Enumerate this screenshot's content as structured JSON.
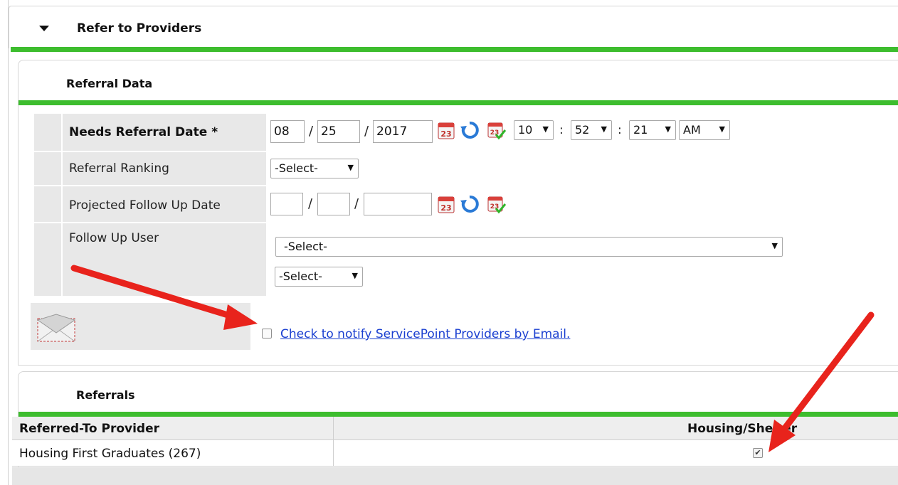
{
  "section": {
    "title": "Refer to Providers"
  },
  "referral_data": {
    "title": "Referral Data",
    "needs_referral_date": {
      "label": "Needs Referral Date",
      "required_mark": "*",
      "month": "08",
      "day": "25",
      "year": "2017",
      "hour": "10",
      "minute": "52",
      "second": "21",
      "ampm": "AM"
    },
    "referral_ranking": {
      "label": "Referral Ranking",
      "value": "-Select-"
    },
    "projected_follow_up_date": {
      "label": "Projected Follow Up Date",
      "month": "",
      "day": "",
      "year": ""
    },
    "follow_up_user": {
      "label": "Follow Up User",
      "value": "-Select-",
      "secondary_value": "-Select-"
    },
    "notify": {
      "label": "Check to notify ServicePoint Providers by Email.",
      "checked": false
    }
  },
  "referrals": {
    "title": "Referrals",
    "columns": [
      "Referred-To Provider",
      "Housing/Shelter"
    ],
    "rows": [
      {
        "provider": "Housing First Graduates (267)",
        "housing_shelter": true
      }
    ]
  },
  "colors": {
    "accent_green": "#3dbd2e",
    "link_blue": "#1a3fd0",
    "annotation_red": "#e8231c"
  },
  "icons": [
    "collapse-triangle-icon",
    "calendar-icon",
    "refresh-icon",
    "calendar-check-icon",
    "envelope-icon",
    "red-arrow-annotation"
  ]
}
